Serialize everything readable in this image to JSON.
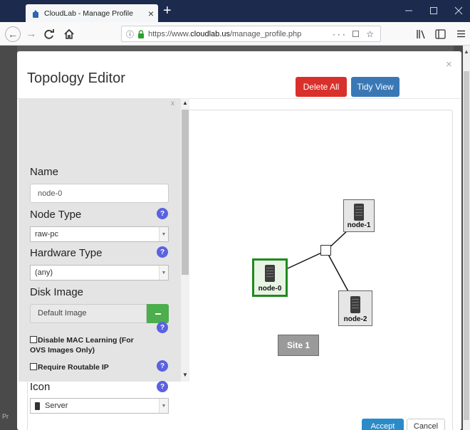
{
  "browser": {
    "tab_title": "CloudLab - Manage Profile",
    "tab_close": "×",
    "new_tab": "+",
    "url_prefix": "https://www.",
    "url_domain": "cloudlab.us",
    "url_path": "/manage_profile.php",
    "url_actions": "··· ☐ ☆"
  },
  "page": {
    "bottom_text": "Pr"
  },
  "modal": {
    "title": "Topology Editor",
    "close": "×",
    "delete_all_label": "Delete All",
    "tidy_view_label": "Tidy View",
    "accept_label": "Accept",
    "cancel_label": "Cancel"
  },
  "properties": {
    "close": "x",
    "name_label": "Name",
    "name_value": "node-0",
    "node_type_label": "Node Type",
    "node_type_value": "raw-pc",
    "hardware_type_label": "Hardware Type",
    "hardware_type_value": "(any)",
    "disk_image_label": "Disk Image",
    "disk_image_value": "Default Image",
    "help_glyph": "?",
    "disable_mac_label_line1": "Disable MAC Learning (For",
    "disable_mac_label_line2": "OVS Images Only)",
    "routable_ip_label": "Require Routable IP",
    "icon_label": "Icon",
    "icon_value": "Server"
  },
  "topology": {
    "nodes": [
      {
        "name": "node-0",
        "selected": true
      },
      {
        "name": "node-1",
        "selected": false
      },
      {
        "name": "node-2",
        "selected": false
      }
    ],
    "site_label": "Site 1"
  },
  "colors": {
    "delete": "#d9302c",
    "tidy": "#3a78b5",
    "selected_node": "#1f8a1f",
    "help": "#5a62e0",
    "add_image": "#4cae4c"
  }
}
